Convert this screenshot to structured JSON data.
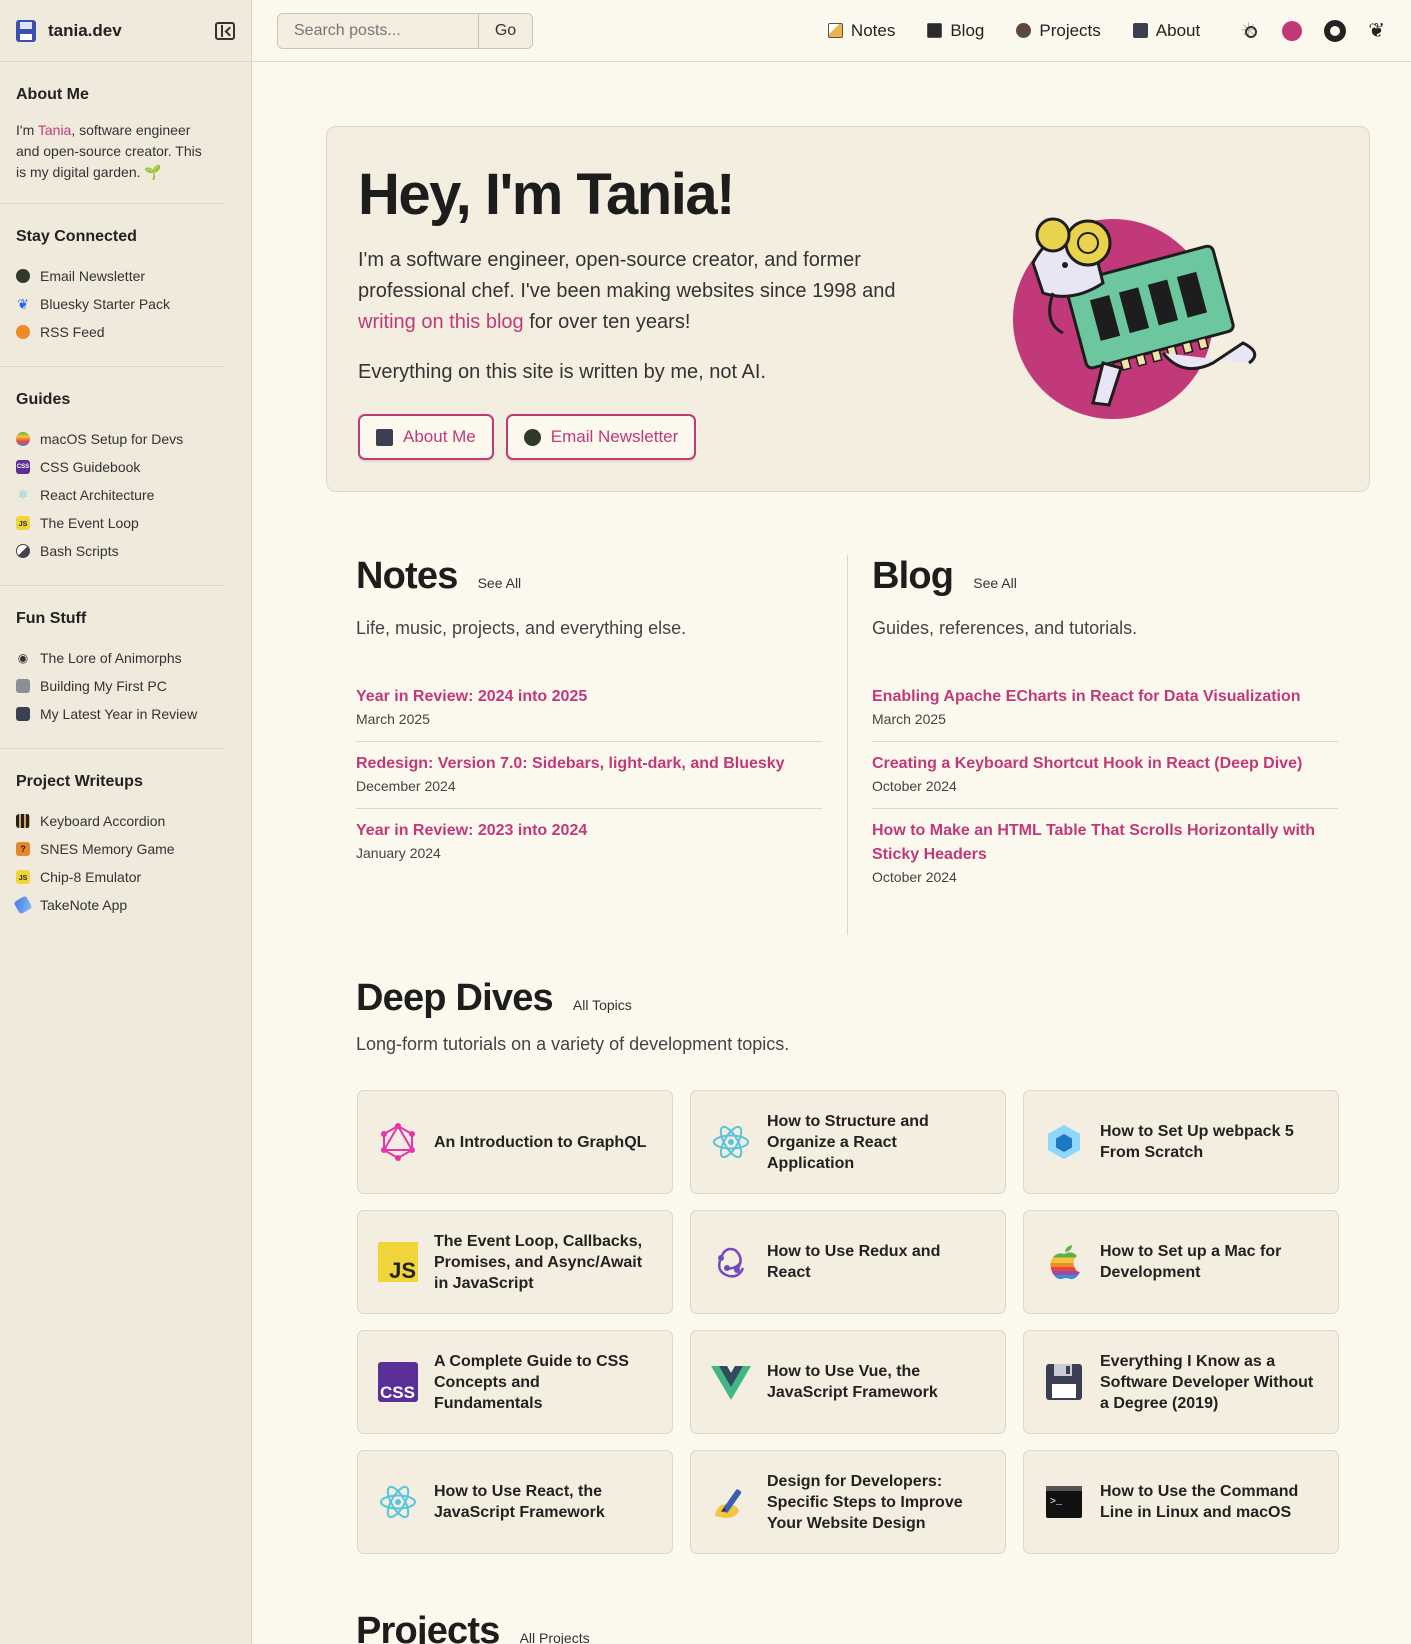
{
  "brand": {
    "name": "tania.dev"
  },
  "search": {
    "placeholder": "Search posts...",
    "button": "Go"
  },
  "nav": {
    "items": [
      {
        "label": "Notes"
      },
      {
        "label": "Blog"
      },
      {
        "label": "Projects"
      },
      {
        "label": "About"
      }
    ]
  },
  "sidebar": {
    "about": {
      "title": "About Me",
      "pre": "I'm ",
      "name": "Tania",
      "post": ", software engineer and open-source creator. This is my digital garden. 🌱"
    },
    "sections": [
      {
        "title": "Stay Connected",
        "items": [
          {
            "label": "Email Newsletter"
          },
          {
            "label": "Bluesky Starter Pack"
          },
          {
            "label": "RSS Feed"
          }
        ]
      },
      {
        "title": "Guides",
        "items": [
          {
            "label": "macOS Setup for Devs"
          },
          {
            "label": "CSS Guidebook"
          },
          {
            "label": "React Architecture"
          },
          {
            "label": "The Event Loop"
          },
          {
            "label": "Bash Scripts"
          }
        ]
      },
      {
        "title": "Fun Stuff",
        "items": [
          {
            "label": "The Lore of Animorphs"
          },
          {
            "label": "Building My First PC"
          },
          {
            "label": "My Latest Year in Review"
          }
        ]
      },
      {
        "title": "Project Writeups",
        "items": [
          {
            "label": "Keyboard Accordion"
          },
          {
            "label": "SNES Memory Game"
          },
          {
            "label": "Chip-8 Emulator"
          },
          {
            "label": "TakeNote App"
          }
        ]
      }
    ]
  },
  "hero": {
    "title": "Hey, I'm Tania!",
    "intro_a": "I'm a software engineer, open-source creator, and former professional chef. I've been making websites since 1998 and ",
    "intro_link": "writing on this blog",
    "intro_b": " for over ten years!",
    "note": "Everything on this site is written by me, not AI.",
    "btn_about": "About Me",
    "btn_newsletter": "Email Newsletter"
  },
  "notes": {
    "title": "Notes",
    "see_all": "See All",
    "subtitle": "Life, music, projects, and everything else.",
    "posts": [
      {
        "title": "Year in Review: 2024 into 2025",
        "date": "March 2025"
      },
      {
        "title": "Redesign: Version 7.0: Sidebars, light-dark, and Bluesky",
        "date": "December 2024"
      },
      {
        "title": "Year in Review: 2023 into 2024",
        "date": "January 2024"
      }
    ]
  },
  "blog": {
    "title": "Blog",
    "see_all": "See All",
    "subtitle": "Guides, references, and tutorials.",
    "posts": [
      {
        "title": "Enabling Apache ECharts in React for Data Visualization",
        "date": "March 2025"
      },
      {
        "title": "Creating a Keyboard Shortcut Hook in React (Deep Dive)",
        "date": "October 2024"
      },
      {
        "title": "How to Make an HTML Table That Scrolls Horizontally with Sticky Headers",
        "date": "October 2024"
      }
    ]
  },
  "deep_dives": {
    "title": "Deep Dives",
    "link": "All Topics",
    "subtitle": "Long-form tutorials on a variety of development topics.",
    "cards": [
      {
        "title": "An Introduction to GraphQL",
        "icon": "graphql-icon"
      },
      {
        "title": "How to Structure and Organize a React Application",
        "icon": "react-icon"
      },
      {
        "title": "How to Set Up webpack 5 From Scratch",
        "icon": "webpack-icon"
      },
      {
        "title": "The Event Loop, Callbacks, Promises, and Async/Await in JavaScript",
        "icon": "javascript-icon"
      },
      {
        "title": "How to Use Redux and React",
        "icon": "redux-icon"
      },
      {
        "title": "How to Set up a Mac for Development",
        "icon": "apple-icon"
      },
      {
        "title": "A Complete Guide to CSS Concepts and Fundamentals",
        "icon": "css-icon"
      },
      {
        "title": "How to Use Vue, the JavaScript Framework",
        "icon": "vue-icon"
      },
      {
        "title": "Everything I Know as a Software Developer Without a Degree (2019)",
        "icon": "floppy-disk-icon"
      },
      {
        "title": "How to Use React, the JavaScript Framework",
        "icon": "react-icon"
      },
      {
        "title": "Design for Developers: Specific Steps to Improve Your Website Design",
        "icon": "writing-hand-icon"
      },
      {
        "title": "How to Use the Command Line in Linux and macOS",
        "icon": "terminal-icon"
      }
    ]
  },
  "projects": {
    "title": "Projects",
    "link": "All Projects"
  },
  "colors": {
    "accent": "#c2397a",
    "background": "#fbf8ee",
    "sidebar": "#efeadb",
    "card": "#f3eedf"
  }
}
